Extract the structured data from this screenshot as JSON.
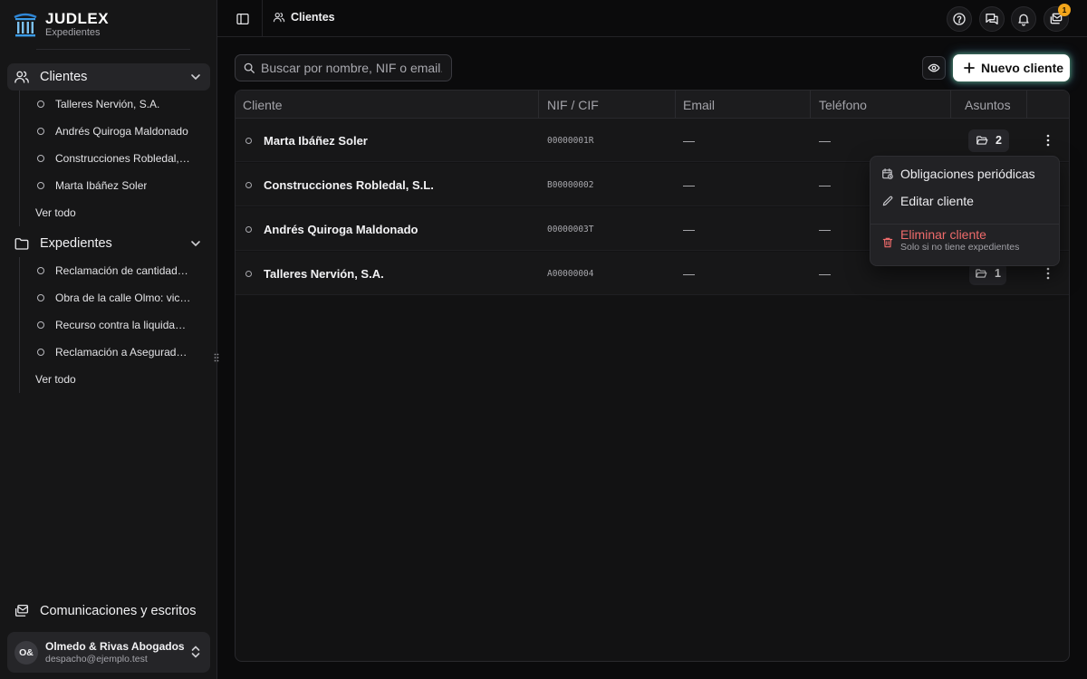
{
  "brand": {
    "name": "JUDLEX",
    "subtitle": "Expedientes"
  },
  "sidebar": {
    "clients": {
      "label": "Clientes",
      "items": [
        "Talleres Nervión, S.A.",
        "Andrés Quiroga Maldonado",
        "Construcciones Robledal, S.L.",
        "Marta Ibáñez Soler"
      ],
      "see_all": "Ver todo"
    },
    "files": {
      "label": "Expedientes",
      "items": [
        "Reclamación de cantidad por impago",
        "Obra de la calle Olmo: vicios ocultos",
        "Recurso contra la liquidación",
        "Reclamación a Aseguradora"
      ],
      "see_all": "Ver todo"
    },
    "communications": "Comunicaciones y escritos",
    "account": {
      "initials": "O&",
      "name": "Olmedo & Rivas Abogados",
      "email": "despacho@ejemplo.test"
    }
  },
  "topbar": {
    "breadcrumb": "Clientes",
    "notifications_badge": "1",
    "icons": [
      "panel-toggle-icon",
      "help-icon",
      "chat-icon",
      "bell-icon",
      "inbox-icon"
    ]
  },
  "toolbar": {
    "search_placeholder": "Buscar por nombre, NIF o email.",
    "new_client_label": "Nuevo cliente"
  },
  "table": {
    "headers": {
      "client": "Cliente",
      "nif": "NIF / CIF",
      "email": "Email",
      "phone": "Teléfono",
      "matters": "Asuntos"
    },
    "rows": [
      {
        "name": "Marta Ibáñez Soler",
        "nif": "00000001R",
        "email": "—",
        "phone": "—",
        "matters": "2"
      },
      {
        "name": "Construcciones Robledal, S.L.",
        "nif": "B00000002",
        "email": "—",
        "phone": "—",
        "matters": ""
      },
      {
        "name": "Andrés Quiroga Maldonado",
        "nif": "00000003T",
        "email": "—",
        "phone": "—",
        "matters": ""
      },
      {
        "name": "Talleres Nervión, S.A.",
        "nif": "A00000004",
        "email": "—",
        "phone": "—",
        "matters": "1"
      }
    ]
  },
  "context_menu": {
    "periodic": "Obligaciones periódicas",
    "edit": "Editar cliente",
    "delete": "Eliminar cliente",
    "delete_hint": "Solo si no tiene expedientes"
  },
  "colors": {
    "accent_warning": "#f2a51b",
    "danger": "#ef6b6b",
    "background": "#0b0b0c",
    "sidebar": "#161617"
  }
}
